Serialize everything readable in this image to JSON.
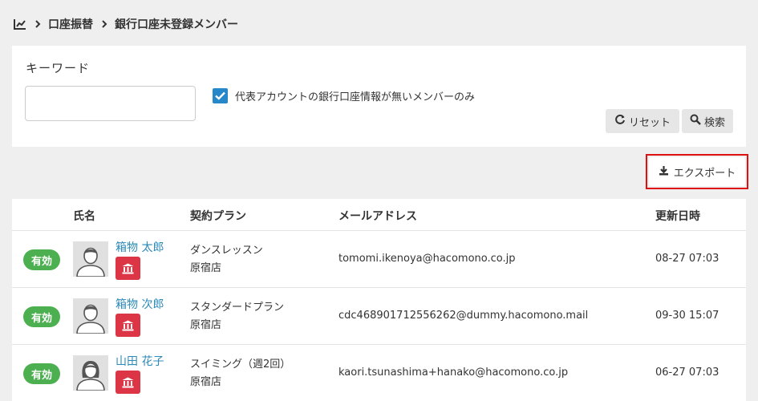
{
  "breadcrumb": {
    "icon": "chart-line-icon",
    "items": [
      "口座振替",
      "銀行口座未登録メンバー"
    ]
  },
  "filter": {
    "keyword_label": "キーワード",
    "keyword_value": "",
    "keyword_placeholder": "",
    "checkbox_checked": true,
    "checkbox_label": "代表アカウントの銀行口座情報が無いメンバーのみ",
    "reset_label": "リセット",
    "search_label": "検索"
  },
  "export_label": "エクスポート",
  "table": {
    "headers": [
      "氏名",
      "契約プラン",
      "メールアドレス",
      "更新日時"
    ],
    "rows": [
      {
        "status": "有効",
        "name": "箱物 太郎",
        "avatar": "male-avatar-icon",
        "plan": "ダンスレッスン",
        "store": "原宿店",
        "email": "tomomi.ikenoya@hacomono.co.jp",
        "updated": "08-27 07:03"
      },
      {
        "status": "有効",
        "name": "箱物 次郎",
        "avatar": "male-avatar-icon",
        "plan": "スタンダードプラン",
        "store": "原宿店",
        "email": "cdc468901712556262@dummy.hacomono.mail",
        "updated": "09-30 15:07"
      },
      {
        "status": "有効",
        "name": "山田 花子",
        "avatar": "female-avatar-icon",
        "plan": "スイミング（週2回）",
        "store": "原宿店",
        "email": "kaori.tsunashima+hanako@hacomono.co.jp",
        "updated": "06-27 07:03"
      }
    ]
  },
  "colors": {
    "accent": "#2687c9",
    "status_active": "#4caf50",
    "bank_badge": "#dc3545",
    "link": "#2b8ab8",
    "highlight": "#e01010"
  }
}
